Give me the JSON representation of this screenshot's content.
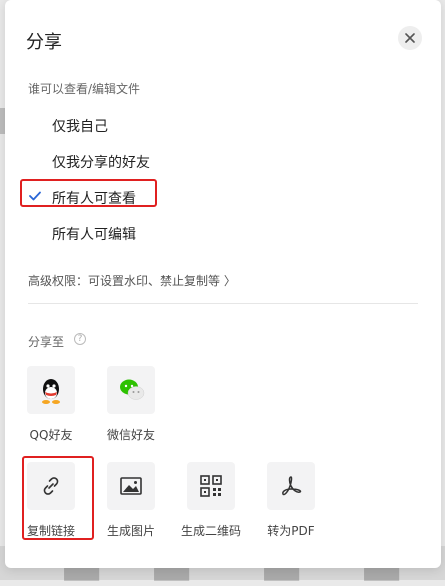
{
  "dialog": {
    "title": "分享",
    "close_icon": "close-icon"
  },
  "permissions": {
    "section_label": "谁可以查看/编辑文件",
    "options": [
      {
        "label": "仅我自己",
        "selected": false
      },
      {
        "label": "仅我分享的好友",
        "selected": false
      },
      {
        "label": "所有人可查看",
        "selected": true
      },
      {
        "label": "所有人可编辑",
        "selected": false
      }
    ],
    "check_color": "#2a66d6"
  },
  "advanced": {
    "label": "高级权限：可设置水印、禁止复制等 〉"
  },
  "share_to": {
    "label": "分享至",
    "help_icon": "question-icon",
    "targets": [
      {
        "label": "QQ好友",
        "icon": "qq-icon"
      },
      {
        "label": "微信好友",
        "icon": "wechat-icon"
      },
      {
        "label": "复制链接",
        "icon": "link-icon"
      },
      {
        "label": "生成图片",
        "icon": "image-icon"
      },
      {
        "label": "生成二维码",
        "icon": "qrcode-icon"
      },
      {
        "label": "转为PDF",
        "icon": "pdf-icon"
      }
    ]
  },
  "colors": {
    "highlight": "#e02020",
    "wechat_green": "#2dc100"
  }
}
